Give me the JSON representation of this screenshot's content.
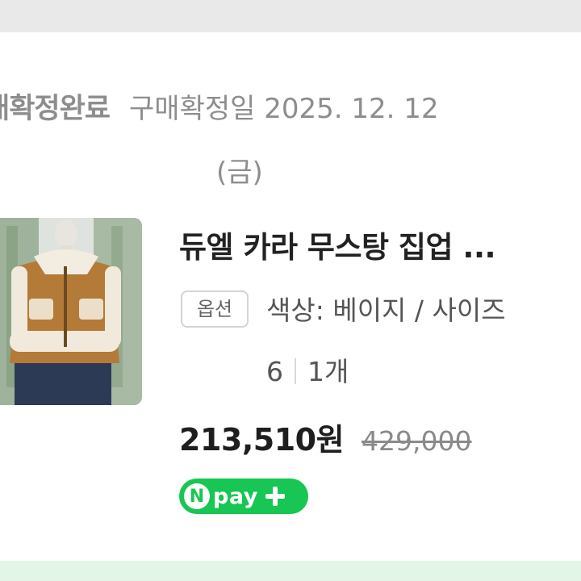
{
  "order": {
    "status": "매확정완료",
    "purchase_date": "구매확정일 2025. 12. 12",
    "weekday": "(금)"
  },
  "product": {
    "name": "듀엘 카라 무스탕 집업 ...",
    "option_badge": "옵션",
    "option_line1": "색상: 베이지 / 사이즈",
    "option_size_cont": "6",
    "quantity": "1개",
    "sale_price": "213,510원",
    "original_price": "429,000"
  },
  "payment": {
    "npay_n": "N",
    "npay_word": "pay",
    "brand_color": "#17c653"
  },
  "icons": [
    "npay-logo-icon",
    "plus-icon"
  ]
}
